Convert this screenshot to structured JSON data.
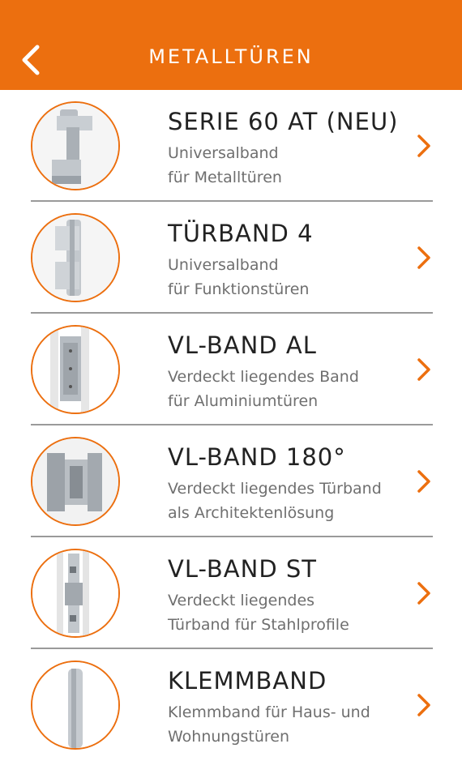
{
  "header": {
    "title": "METALLTÜREN",
    "back_icon": "chevron-left-icon"
  },
  "colors": {
    "accent": "#ec6f0f",
    "title_text": "#222222",
    "desc_text": "#6f6f6f"
  },
  "items": [
    {
      "name": "SERIE 60 AT (NEU)",
      "line1": "Universalband",
      "line2": "für Metalltüren"
    },
    {
      "name": "TÜRBAND 4",
      "line1": "Universalband",
      "line2": "für Funktionstüren"
    },
    {
      "name": "VL-BAND AL",
      "line1": "Verdeckt liegendes Band",
      "line2": "für Aluminiumtüren"
    },
    {
      "name": "VL-BAND 180°",
      "line1": "Verdeckt liegendes Türband",
      "line2": "als Architektenlösung"
    },
    {
      "name": "VL-BAND ST",
      "line1": "Verdeckt liegendes",
      "line2": "Türband für Stahlprofile"
    },
    {
      "name": "KLEMMBAND",
      "line1": "Klemmband für Haus- und",
      "line2": "Wohnungstüren"
    }
  ]
}
